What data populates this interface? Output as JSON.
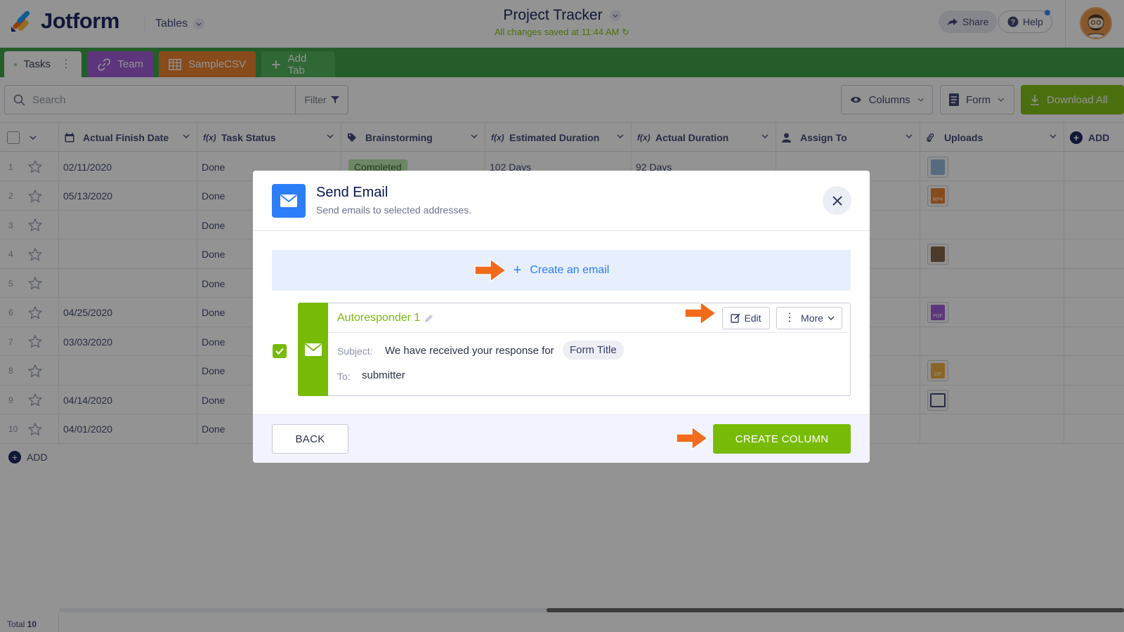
{
  "app": {
    "brand": "Jotform",
    "section_menu": "Tables"
  },
  "project": {
    "title": "Project Tracker",
    "saved_status": "All changes saved at 11:44 AM"
  },
  "header_actions": {
    "share": "Share",
    "help": "Help"
  },
  "tabs": [
    {
      "label": "Tasks",
      "color": "#ffffff"
    },
    {
      "label": "Team",
      "color": "#9a4fd3"
    },
    {
      "label": "SampleCSV",
      "color": "#e8781f"
    },
    {
      "label": "Add Tab",
      "color": "#45ae4f"
    }
  ],
  "toolbar": {
    "search_placeholder": "Search",
    "filter": "Filter",
    "columns": "Columns",
    "form": "Form",
    "download_all": "Download All"
  },
  "columns": [
    {
      "label": "Actual Finish Date",
      "icon": "calendar-icon"
    },
    {
      "label": "Task Status",
      "icon": "fx"
    },
    {
      "label": "Brainstorming",
      "icon": "tag-icon"
    },
    {
      "label": "Estimated Duration",
      "icon": "fx"
    },
    {
      "label": "Actual Duration",
      "icon": "fx"
    },
    {
      "label": "Assign To",
      "icon": "user-icon"
    },
    {
      "label": "Uploads",
      "icon": "paperclip-icon"
    }
  ],
  "add_column_label": "ADD",
  "rows": [
    {
      "num": "1",
      "finish": "02/11/2020",
      "status": "Done",
      "brainstorm": "Completed",
      "est": "102 Days",
      "actual": "92 Days",
      "upload": "image"
    },
    {
      "num": "2",
      "finish": "05/13/2020",
      "status": "Done",
      "brainstorm": "",
      "est": "",
      "actual": "",
      "upload": "MP4"
    },
    {
      "num": "3",
      "finish": "",
      "status": "Done",
      "brainstorm": "",
      "est": "",
      "actual": "",
      "upload": ""
    },
    {
      "num": "4",
      "finish": "",
      "status": "Done",
      "brainstorm": "",
      "est": "",
      "actual": "",
      "upload": "photo"
    },
    {
      "num": "5",
      "finish": "",
      "status": "Done",
      "brainstorm": "",
      "est": "",
      "actual": "",
      "upload": ""
    },
    {
      "num": "6",
      "finish": "04/25/2020",
      "status": "Done",
      "brainstorm": "",
      "est": "",
      "actual": "",
      "upload": "PDF"
    },
    {
      "num": "7",
      "finish": "03/03/2020",
      "status": "Done",
      "brainstorm": "",
      "est": "",
      "actual": "",
      "upload": ""
    },
    {
      "num": "8",
      "finish": "",
      "status": "Done",
      "brainstorm": "",
      "est": "",
      "actual": "",
      "upload": "ZIP"
    },
    {
      "num": "9",
      "finish": "04/14/2020",
      "status": "Done",
      "brainstorm": "",
      "est": "",
      "actual": "",
      "upload": "frame"
    },
    {
      "num": "10",
      "finish": "04/01/2020",
      "status": "Done",
      "brainstorm": "",
      "est": "",
      "actual": "",
      "upload": ""
    }
  ],
  "add_row_label": "ADD",
  "footer": {
    "total_label": "Total",
    "total_count": "10"
  },
  "modal": {
    "title": "Send Email",
    "subtitle": "Send emails to selected addresses.",
    "create_email": "Create an email",
    "autoresponder": {
      "name": "Autoresponder 1",
      "checked": true,
      "edit": "Edit",
      "more": "More",
      "subject_label": "Subject:",
      "subject": "We have received your response for",
      "subject_chip": "Form Title",
      "to_label": "To:",
      "to": "submitter"
    },
    "back": "BACK",
    "create_column": "CREATE COLUMN"
  },
  "colors": {
    "brand_green": "#78bb07",
    "tab_bar": "#2f9a3a",
    "blue": "#2b7df8",
    "arrow_orange": "#f26b1d"
  }
}
